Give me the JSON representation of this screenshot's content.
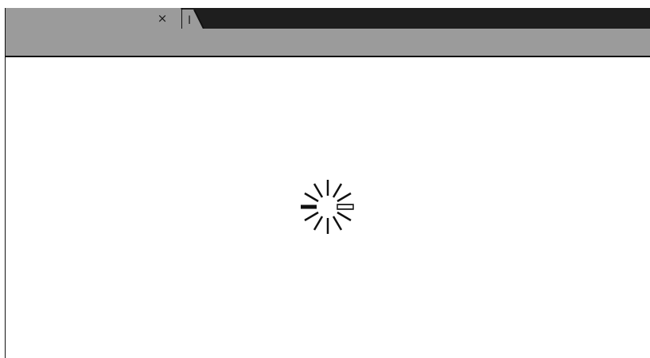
{
  "tabs": {
    "close_glyph": "×",
    "new_tab_glyph": "I",
    "close_icon": "close-icon",
    "new_tab_icon": "new-tab-icon"
  },
  "content": {
    "state": "loading",
    "spinner_icon": "loading-spinner-icon"
  },
  "colors": {
    "chrome_gray": "#9b9b9b",
    "tab_strip": "#1e1e1e",
    "border": "#111111",
    "page_bg": "#ffffff"
  }
}
